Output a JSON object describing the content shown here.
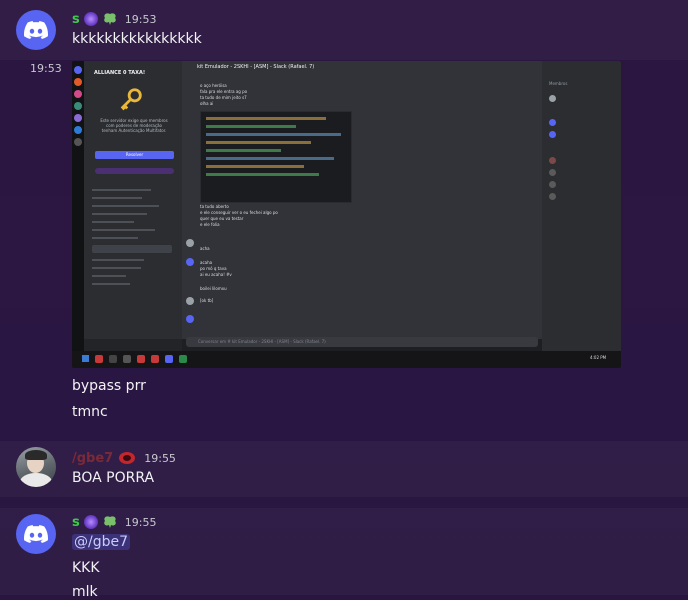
{
  "messages": [
    {
      "author": "s",
      "timestamp": "19:53",
      "text": "kkkkkkkkkkkkkkkk"
    },
    {
      "side_timestamp": "19:53"
    },
    {
      "lines": [
        "bypass prr",
        "tmnc"
      ]
    },
    {
      "author": "/gbe7",
      "timestamp": "19:55",
      "text": "BOA PORRA"
    },
    {
      "author": "s",
      "timestamp": "19:55",
      "mention": "@/gbe7",
      "lines": [
        "KKK",
        "mlk"
      ]
    }
  ],
  "embedded_screenshot": {
    "server_name": "ALLIANCE 0 TAXA!",
    "channel_title": "kit Emulador - 2SKHI - [ASM] - Slack (Rafael. 7)",
    "verify_text": "Este servidor exige que membros com poderes de moderação tenham Autenticação Multifator.",
    "verify_button": "Resolver",
    "members_header": "Membros",
    "chat_lines": [
      "o aço heróisa",
      "fala pra ele entra ag po",
      "ta tudo de mim jeito s7",
      "olha ai",
      "ta tudo aberto",
      "e ele conseguir ver o eu fechei algo po",
      "quer que eu va testar",
      "e ele folia",
      "acha",
      "acaha",
      "po mó q tava",
      "ai eu acaha! #v",
      "boilei lilomxu",
      "[ok tb]"
    ],
    "input_placeholder": "Conversar em #  kit Emulador - 2SKHI - [ASM] - Slack (Rafael. 7)",
    "taskbar_time": "4:02 PM"
  },
  "colors": {
    "accent": "#5865f2",
    "name_green": "#3ec94b",
    "name_red": "#7a2a38"
  }
}
